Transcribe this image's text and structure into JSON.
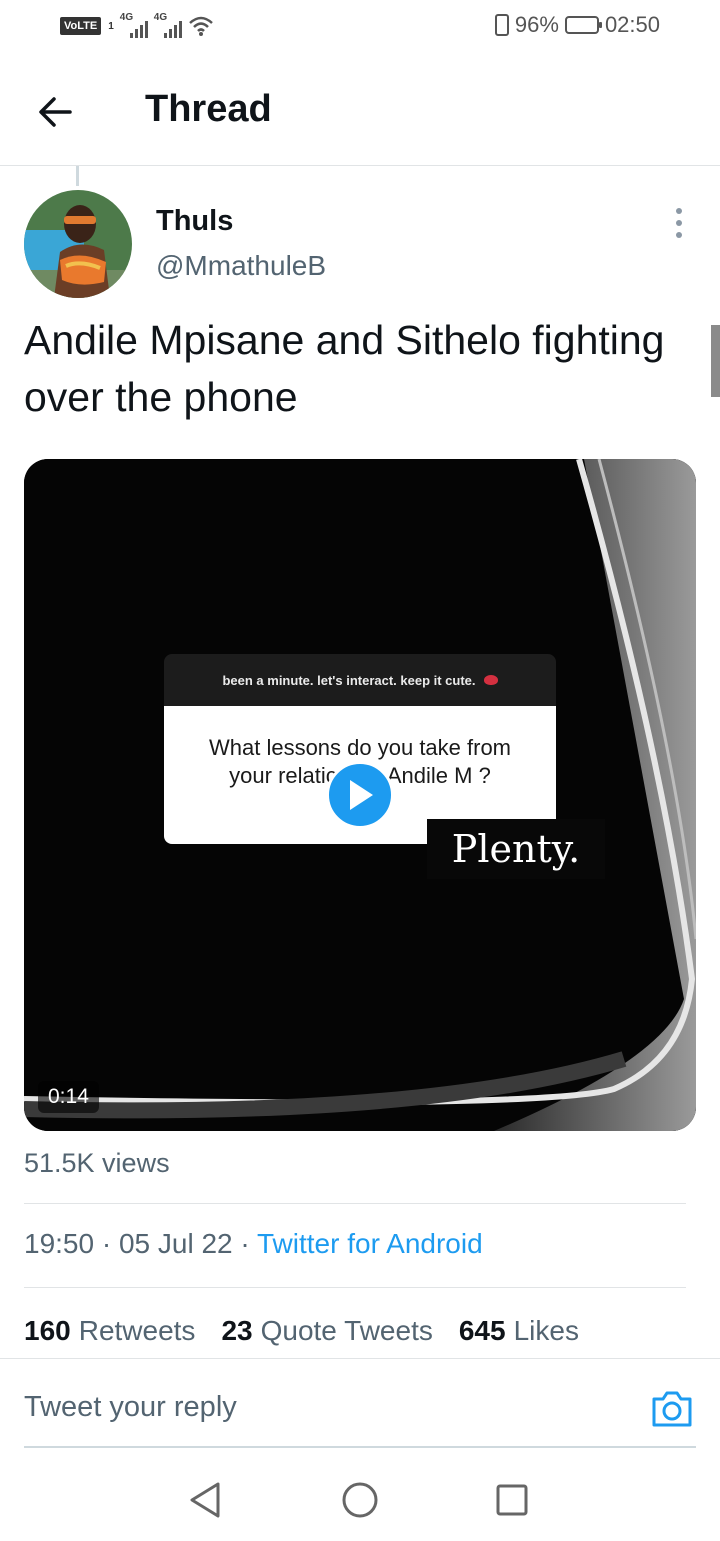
{
  "status_bar": {
    "volte": "VoLTE",
    "volte_sub": "1",
    "network_1": "4G",
    "network_2": "4G",
    "battery": "96%",
    "time": "02:50",
    "battery_level": 0.96
  },
  "header": {
    "title": "Thread",
    "back_icon": "arrow-left-icon"
  },
  "tweet": {
    "display_name": "Thuls",
    "handle": "@MmathuleB",
    "text": "Andile Mpisane and Sithelo fighting over the phone",
    "media": {
      "question_header": "been a minute. let's interact. keep it cute.",
      "question_text": "What lessons do you take from your relatic      with Andile M      ?",
      "answer": "Plenty.",
      "duration": "0:14",
      "play_icon": "play-icon"
    },
    "views": "51.5K views",
    "time": "19:50",
    "date": "05 Jul 22",
    "separator": "·",
    "source": "Twitter for Android",
    "stats": [
      {
        "count": "160",
        "label": "Retweets"
      },
      {
        "count": "23",
        "label": "Quote Tweets"
      },
      {
        "count": "645",
        "label": "Likes"
      }
    ]
  },
  "reply": {
    "placeholder": "Tweet your reply",
    "camera_icon": "camera-icon"
  },
  "nav": {
    "back": "nav-back-icon",
    "home": "nav-home-icon",
    "recents": "nav-recents-icon"
  },
  "colors": {
    "accent": "#1d9bf0",
    "text_primary": "#0f1419",
    "text_secondary": "#536471",
    "divider": "#e1e4e6"
  }
}
